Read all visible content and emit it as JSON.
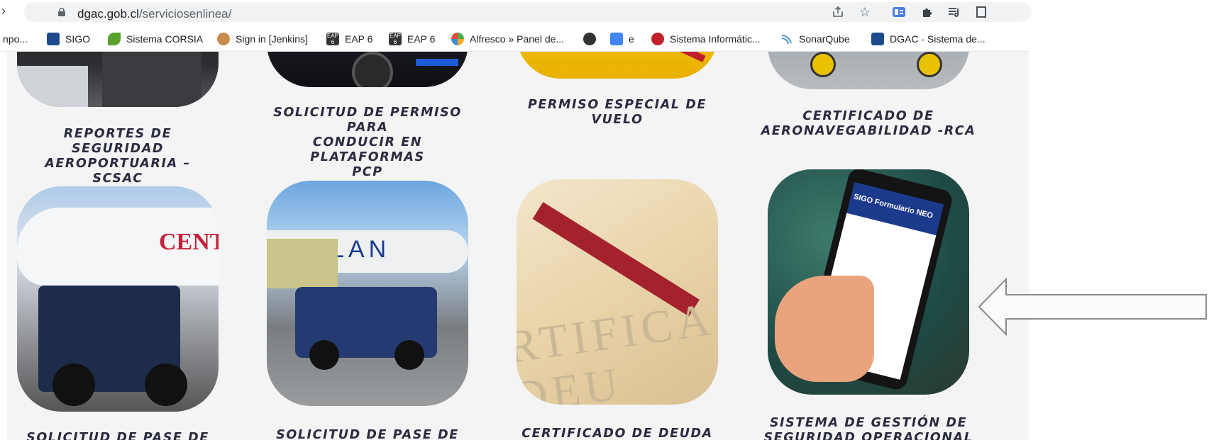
{
  "browser": {
    "url_host": "dgac.gob.cl",
    "url_path": "/serviciosenlinea/",
    "bookmarks": [
      {
        "label": "npo...",
        "icon": "none"
      },
      {
        "label": "SIGO",
        "icon": "sigo-logo-icon",
        "color": "#1e4b8f"
      },
      {
        "label": "Sistema CORSIA",
        "icon": "leaf-icon",
        "color": "#5aa02c"
      },
      {
        "label": "Sign in [Jenkins]",
        "icon": "jenkins-icon",
        "color": "#c98a4b"
      },
      {
        "label": "EAP 6",
        "icon": "eap-icon",
        "color": "#333333"
      },
      {
        "label": "EAP 6",
        "icon": "eap-icon",
        "color": "#333333"
      },
      {
        "label": "Alfresco » Panel de...",
        "icon": "alfresco-icon",
        "color": "#4cae4c"
      },
      {
        "label": "",
        "icon": "globe-icon",
        "color": "#333333"
      },
      {
        "label": "e",
        "icon": "docs-icon",
        "color": "#4285f4"
      },
      {
        "label": "Sistema Informátic...",
        "icon": "red-logo-icon",
        "color": "#c0202a"
      },
      {
        "label": "SonarQube",
        "icon": "sonar-icon",
        "color": "#4e9bcd"
      },
      {
        "label": "DGAC - Sistema de...",
        "icon": "dgac-logo-icon",
        "color": "#1e4b8f"
      }
    ]
  },
  "services": {
    "row1": [
      {
        "caption_lines": [
          "REPORTES DE SEGURIDAD",
          "AEROPORTUARIA – SCSAC"
        ]
      },
      {
        "caption_lines": [
          "SOLICITUD DE PERMISO PARA",
          "CONDUCIR EN PLATAFORMAS",
          "PCP"
        ]
      },
      {
        "caption_lines": [
          "PERMISO ESPECIAL DE VUELO"
        ]
      },
      {
        "caption_lines": [
          "CERTIFICADO DE",
          "AERONAVEGABILIDAD -RCA"
        ]
      }
    ],
    "row2": [
      {
        "caption_lines": [
          "SOLICITUD DE PASE DE ACCESO"
        ],
        "image_text": "CENTUR"
      },
      {
        "caption_lines": [
          "SOLICITUD DE PASE DE ACCESO"
        ],
        "image_text": "LAN"
      },
      {
        "caption_lines": [
          "CERTIFICADO DE DEUDA"
        ],
        "image_text": "RTIFICA DEU"
      },
      {
        "caption_lines": [
          "SISTEMA DE GESTIÓN DE",
          "SEGURIDAD OPERACIONAL"
        ],
        "image_text": "SIGO Formulario NEO"
      }
    ]
  },
  "colors": {
    "caption": "#2b2b40",
    "page_bg": "#f4f4f5",
    "link_blue": "#1a3c8f"
  }
}
